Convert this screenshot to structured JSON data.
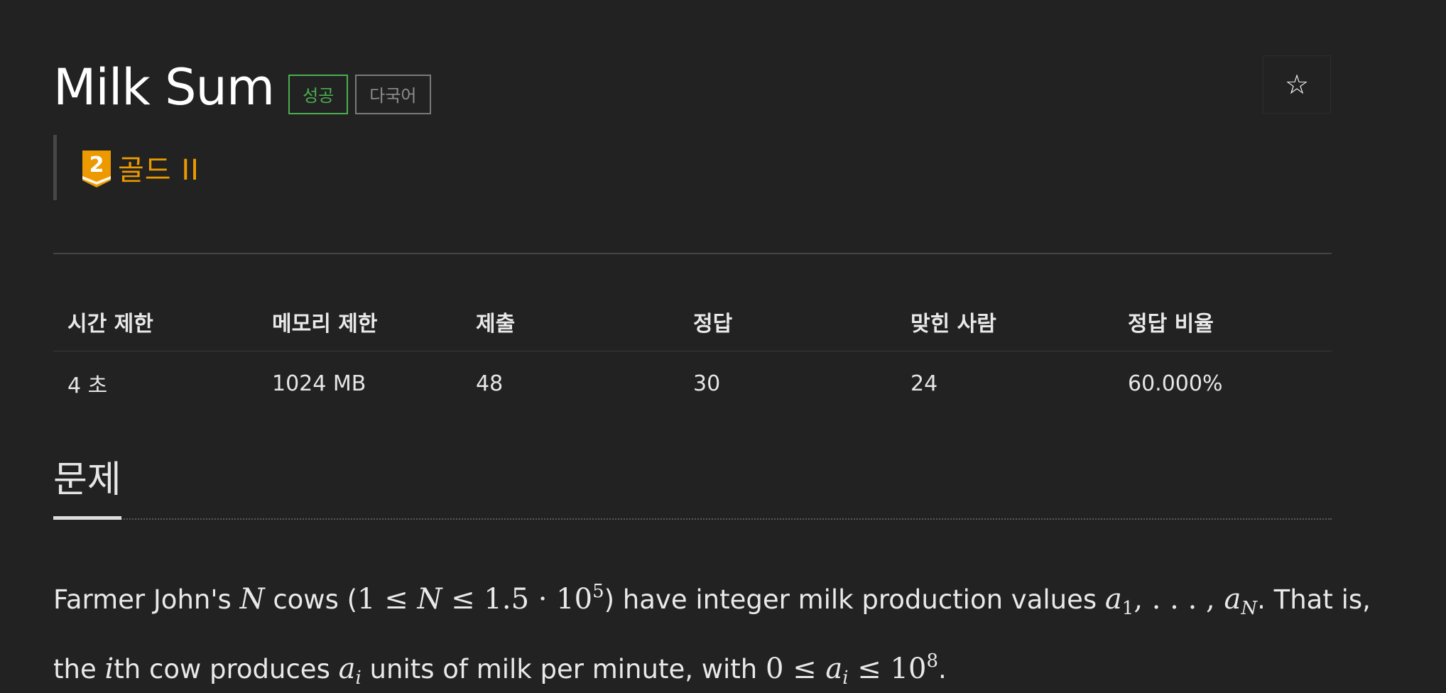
{
  "problem": {
    "title": "Milk Sum",
    "labels": {
      "success": "성공",
      "multilang": "다국어"
    },
    "star_glyph": "☆",
    "tier": {
      "number": "2",
      "text": "골드 II",
      "color": "#ec9a00"
    }
  },
  "stats": {
    "headers": [
      "시간 제한",
      "메모리 제한",
      "제출",
      "정답",
      "맞힌 사람",
      "정답 비율"
    ],
    "values": [
      "4 초",
      "1024 MB",
      "48",
      "30",
      "24",
      "60.000%"
    ]
  },
  "section": {
    "title": "문제"
  },
  "statement": {
    "line1": {
      "t1": "Farmer John's ",
      "N": "N",
      "t2": " cows (",
      "math1": "1 ≤ ",
      "N2": "N",
      "math2": " ≤ 1.5 · 10",
      "exp1": "5",
      "t3": ") have integer milk production values ",
      "a": "a",
      "sub1": "1",
      "dots": ", . . . , ",
      "a2": "a",
      "subN": "N",
      "t4": ". That is,"
    },
    "line2": {
      "t1": "the ",
      "i": "i",
      "t2": "th cow produces ",
      "a": "a",
      "subi": "i",
      "t3": " units of milk per minute, with ",
      "math1": "0 ≤ ",
      "a2": "a",
      "subi2": "i",
      "math2": " ≤ 10",
      "exp": "8",
      "t4": "."
    }
  }
}
